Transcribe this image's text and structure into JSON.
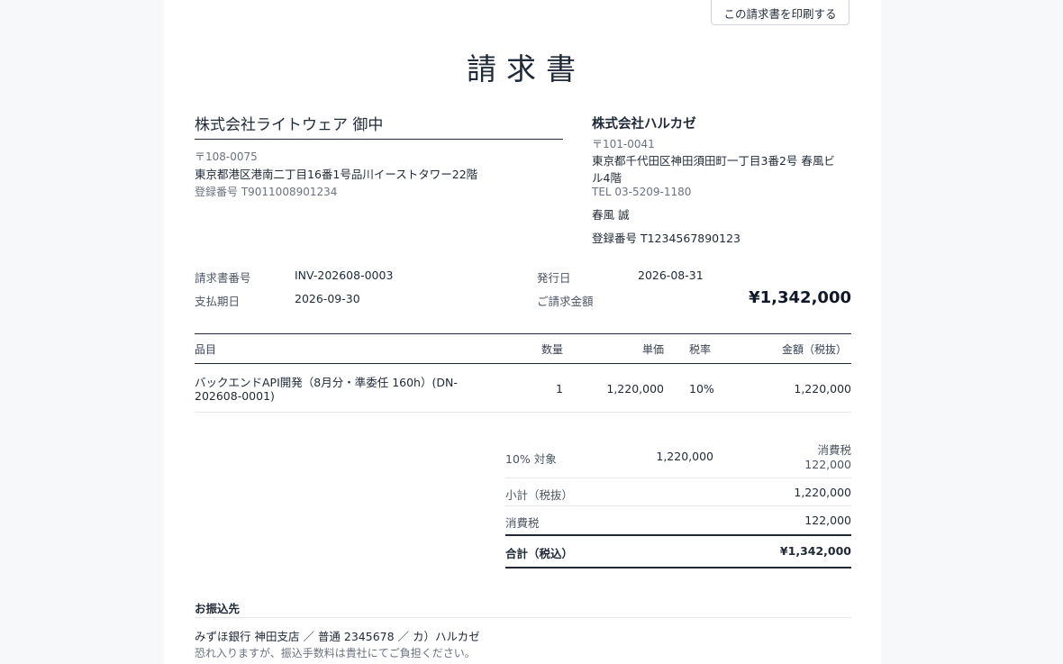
{
  "print_button": "この請求書を印刷する",
  "title": "請求書",
  "client": {
    "name": "株式会社ライトウェア 御中",
    "postal": "〒108-0075",
    "address": "東京都港区港南二丁目16番1号品川イーストタワー22階",
    "registration": "登録番号 T9011008901234"
  },
  "issuer": {
    "name": "株式会社ハルカゼ",
    "postal": "〒101-0041",
    "address_line1": "東京都千代田区神田須田町一丁目3番2号 春風ビ",
    "address_line2": "ル4階",
    "tel": "TEL 03-5209-1180",
    "person": "春風 誠",
    "registration": "登録番号 T1234567890123"
  },
  "meta": {
    "invoice_no_label": "請求書番号",
    "invoice_no": "INV-202608-0003",
    "issue_date_label": "発行日",
    "issue_date": "2026-08-31",
    "due_date_label": "支払期日",
    "due_date": "2026-09-30",
    "amount_label": "ご請求金額",
    "amount": "¥1,342,000"
  },
  "table": {
    "headers": {
      "item": "品目",
      "qty": "数量",
      "unit_price": "単価",
      "tax_rate": "税率",
      "amount": "金額（税抜）"
    },
    "rows": [
      {
        "item_line1": "バックエンドAPI開発（8月分・準委任 160h）(DN-",
        "item_line2": "202608-0001)",
        "qty": "1",
        "unit_price": "1,220,000",
        "tax_rate": "10%",
        "amount": "1,220,000"
      }
    ]
  },
  "summary": {
    "tax10_label": "10% 対象",
    "tax10_base": "1,220,000",
    "tax10_tax_label": "消費税",
    "tax10_tax": "122,000",
    "subtotal_label": "小計（税抜）",
    "subtotal": "1,220,000",
    "tax_label": "消費税",
    "tax": "122,000",
    "total_label": "合計（税込）",
    "total": "¥1,342,000"
  },
  "bank": {
    "heading": "お振込先",
    "account": "みずほ銀行 神田支店 ／ 普通 2345678 ／ カ）ハルカゼ",
    "note": "恐れ入りますが、振込手数料は貴社にてご負担ください。"
  }
}
